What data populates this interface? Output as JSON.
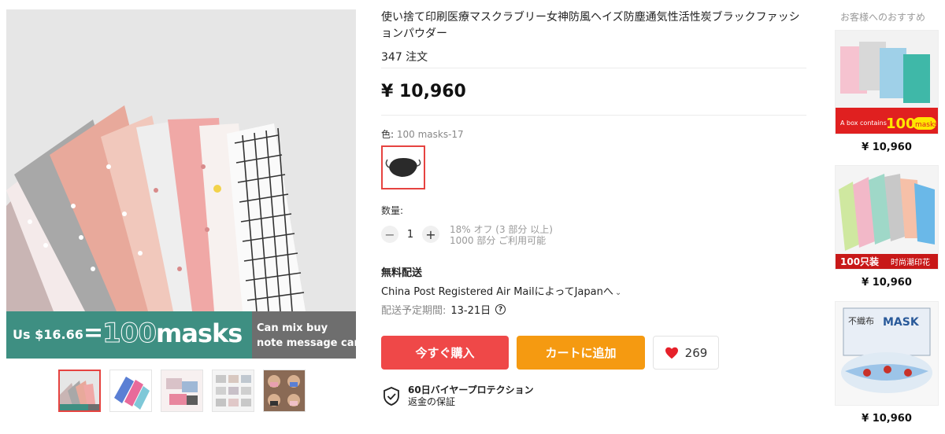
{
  "gallery": {
    "banner": {
      "price": "Us $16.66",
      "equals": "=",
      "count": "100",
      "unit": "masks",
      "right_line1": "Can mix buy",
      "right_line2": "note message can be"
    },
    "thumbnails": [
      {
        "name": "thumb-mixed-patterns",
        "active": true
      },
      {
        "name": "thumb-floral-masks",
        "active": false
      },
      {
        "name": "thumb-pink-masks",
        "active": false
      },
      {
        "name": "thumb-grid-masks",
        "active": false
      },
      {
        "name": "thumb-models",
        "active": false
      }
    ]
  },
  "product": {
    "title": "使い捨て印刷医療マスクラブリー女神防風ヘイズ防塵通気性活性炭ブラックファッションパウダー",
    "orders": "347 注文",
    "price": "¥ 10,960",
    "color_label": "色:",
    "color_value": "100 masks-17",
    "quantity_label": "数量:",
    "quantity_value": "1",
    "quantity_minus": "−",
    "quantity_plus": "+",
    "discount_note": "18% オフ (3 部分 以上)",
    "stock_note": "1000 部分 ご利用可能",
    "shipping_title": "無料配送",
    "shipping_method": "China Post Registered Air MailによってJapanへ",
    "shipping_chevron": "⌄",
    "delivery_label": "配送予定期間:",
    "delivery_value": "13-21日",
    "help_icon": "?",
    "buy_now": "今すぐ購入",
    "add_to_cart": "カートに追加",
    "wishlist_count": "269",
    "protection_title": "60日バイヤープロテクション",
    "protection_sub": "返金の保証"
  },
  "recommendations": {
    "title": "お客様へのおすすめ",
    "items": [
      {
        "price": "¥ 10,960",
        "badge_text": "A box contains",
        "badge_count": "100",
        "badge_unit": "masks"
      },
      {
        "price": "¥ 10,960",
        "badge_text": "100只装",
        "badge_sub": "时尚潮印花"
      },
      {
        "price": "¥ 10,960",
        "label_top": "不織布",
        "label_brand": "MASK"
      }
    ]
  },
  "colors": {
    "accent_red": "#ef4848",
    "accent_orange": "#f59a11",
    "banner_teal": "#3e8f82",
    "selected_border": "#e64340"
  }
}
